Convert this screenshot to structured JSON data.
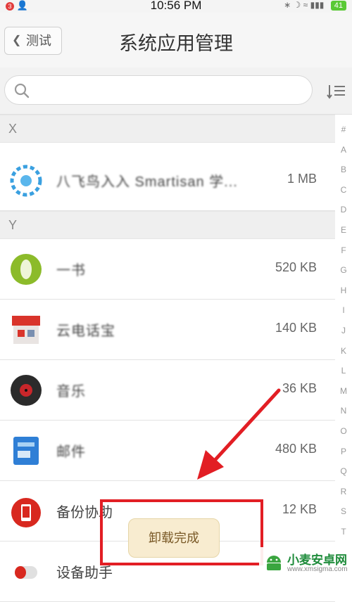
{
  "status_bar": {
    "badge": "3",
    "time": "10:56 PM",
    "battery": "41"
  },
  "nav": {
    "back_label": "测试",
    "title": "系统应用管理"
  },
  "search": {
    "placeholder": ""
  },
  "sections": [
    {
      "letter": "X",
      "apps": [
        {
          "name": "八飞鸟入入 Smartisan 学...",
          "size": "1 MB",
          "icon": "blue-gear-icon"
        }
      ]
    },
    {
      "letter": "Y",
      "apps": [
        {
          "name": "一书",
          "size": "520 KB",
          "icon": "green-circle-icon"
        },
        {
          "name": "云电话宝",
          "size": "140 KB",
          "icon": "store-icon"
        },
        {
          "name": "音乐",
          "size": "36 KB",
          "icon": "vinyl-icon"
        },
        {
          "name": "邮件",
          "size": "480 KB",
          "icon": "blue-doc-icon"
        },
        {
          "name": "备份协助",
          "size": "12 KB",
          "icon": "red-phone-icon"
        },
        {
          "name": "设备助手",
          "size": "",
          "icon": "capsule-icon"
        }
      ]
    }
  ],
  "index_letters": [
    "#",
    "A",
    "B",
    "C",
    "D",
    "E",
    "F",
    "G",
    "H",
    "I",
    "J",
    "K",
    "L",
    "M",
    "N",
    "O",
    "P",
    "Q",
    "R",
    "S",
    "T"
  ],
  "toast": {
    "text": "卸载完成"
  },
  "watermark": {
    "name": "小麦安卓网",
    "url": "www.xmsigma.com"
  },
  "colors": {
    "annotation": "#e21e24",
    "toast_bg": "#f8ecd0",
    "battery": "#59c935"
  }
}
